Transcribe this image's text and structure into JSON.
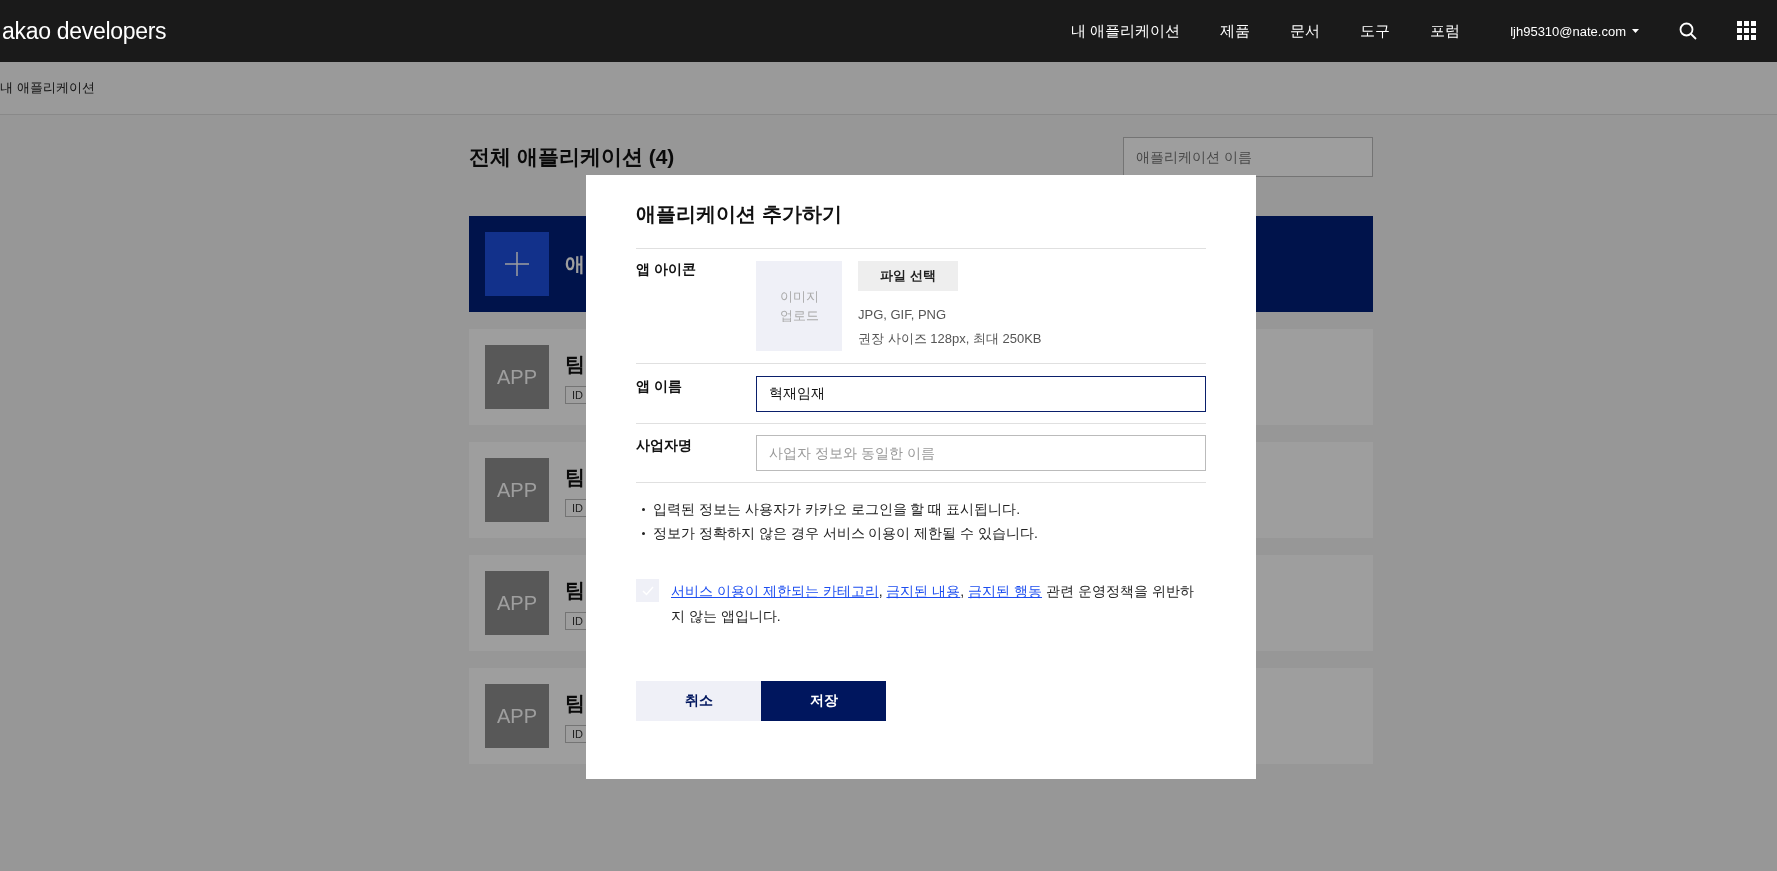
{
  "header": {
    "logo": "akao developers",
    "nav": [
      {
        "label": "내 애플리케이션"
      },
      {
        "label": "제품"
      },
      {
        "label": "문서"
      },
      {
        "label": "도구"
      },
      {
        "label": "포럼"
      }
    ],
    "account": "ljh95310@nate.com"
  },
  "breadcrumb": "내 애플리케이션",
  "page": {
    "title": "전체 애플리케이션 (4)",
    "search": {
      "placeholder": "애플리케이션 이름"
    },
    "add_card": {
      "label": "애"
    },
    "apps": [
      {
        "thumb": "APP",
        "name": "팀",
        "tag": "ID"
      },
      {
        "thumb": "APP",
        "name": "팀",
        "tag": "ID"
      },
      {
        "thumb": "APP",
        "name": "팀",
        "tag": "ID"
      },
      {
        "thumb": "APP",
        "name": "팀",
        "tag": "ID"
      }
    ]
  },
  "dialog": {
    "title": "애플리케이션 추가하기",
    "icon_row": {
      "label": "앱 아이콘",
      "upload_lines": [
        "이미지",
        "업로드"
      ],
      "file_button": "파일 선택",
      "hints": [
        "JPG, GIF, PNG",
        "권장 사이즈 128px, 최대 250KB"
      ]
    },
    "name_row": {
      "label": "앱 이름",
      "value": "혁재임재"
    },
    "business_row": {
      "label": "사업자명",
      "placeholder": "사업자 정보와 동일한 이름"
    },
    "notes": [
      "입력된 정보는 사용자가 카카오 로그인을 할 때 표시됩니다.",
      "정보가 정확하지 않은 경우 서비스 이용이 제한될 수 있습니다."
    ],
    "agreement": {
      "checked": false,
      "parts": [
        {
          "kind": "link",
          "text": "서비스 이용이 제한되는 카테고리"
        },
        {
          "kind": "text",
          "text": ", "
        },
        {
          "kind": "link",
          "text": "금지된 내용"
        },
        {
          "kind": "text",
          "text": ", "
        },
        {
          "kind": "link",
          "text": "금지된 행동"
        },
        {
          "kind": "text",
          "text": " 관련 운영정책을 위반하지 않는 앱입니다."
        }
      ]
    },
    "buttons": [
      {
        "kind": "secondary",
        "label": "취소"
      },
      {
        "kind": "primary",
        "label": "저장"
      }
    ]
  }
}
